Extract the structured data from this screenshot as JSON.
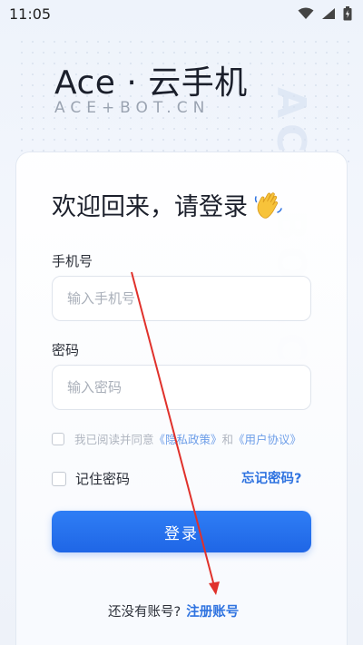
{
  "statusbar": {
    "time": "11:05",
    "icons": [
      "wifi-icon",
      "signal-icon",
      "battery-icon"
    ]
  },
  "brand": {
    "title": "Ace · 云手机",
    "subtitle": "ACE+BOT.CN",
    "watermark": "ACE BOT.CN"
  },
  "login": {
    "welcome": "欢迎回来，请登录",
    "welcome_icon": "waving-hand-icon",
    "phone_label": "手机号",
    "phone_placeholder": "输入手机号",
    "phone_value": "",
    "password_label": "密码",
    "password_placeholder": "输入密码",
    "password_value": "",
    "agree_prefix": "我已阅读并同意",
    "privacy_link": "《隐私政策》",
    "agree_and": "和",
    "terms_link": "《用户协议》",
    "remember_label": "记住密码",
    "forgot_link": "忘记密码?",
    "login_button": "登录",
    "register_prompt": "还没有账号?",
    "register_link": "注册账号"
  },
  "colors": {
    "accent": "#2f73e0",
    "button": "#1f66e6",
    "annotation": "#e0312b"
  }
}
